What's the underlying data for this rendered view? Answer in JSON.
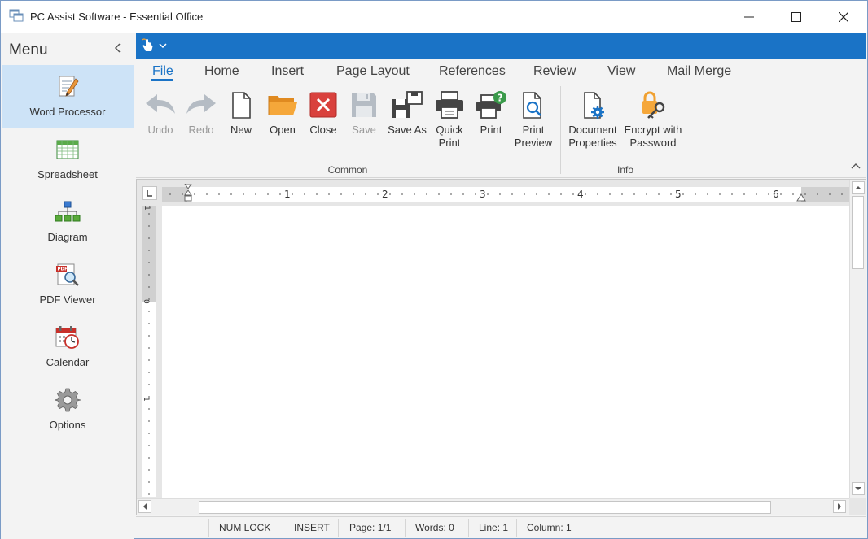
{
  "window": {
    "title": "PC Assist Software - Essential Office"
  },
  "sidebar": {
    "title": "Menu",
    "items": [
      {
        "label": "Word Processor",
        "icon": "word-processor-icon",
        "active": true
      },
      {
        "label": "Spreadsheet",
        "icon": "spreadsheet-icon"
      },
      {
        "label": "Diagram",
        "icon": "diagram-icon"
      },
      {
        "label": "PDF Viewer",
        "icon": "pdf-viewer-icon"
      },
      {
        "label": "Calendar",
        "icon": "calendar-icon"
      },
      {
        "label": "Options",
        "icon": "options-icon"
      }
    ]
  },
  "tabs": [
    "File",
    "Home",
    "Insert",
    "Page Layout",
    "References",
    "Review",
    "View",
    "Mail Merge"
  ],
  "active_tab": "File",
  "ribbon": {
    "groups": [
      {
        "label": "Common"
      },
      {
        "label": "Info"
      }
    ],
    "buttons": {
      "undo": {
        "label": "Undo",
        "disabled": true
      },
      "redo": {
        "label": "Redo",
        "disabled": true
      },
      "new": {
        "label": "New"
      },
      "open": {
        "label": "Open"
      },
      "close": {
        "label": "Close"
      },
      "save": {
        "label": "Save",
        "disabled": true
      },
      "save_as": {
        "label": "Save As"
      },
      "quick_print": {
        "label1": "Quick",
        "label2": "Print"
      },
      "print": {
        "label": "Print"
      },
      "print_preview": {
        "label1": "Print",
        "label2": "Preview"
      },
      "document_properties": {
        "label1": "Document",
        "label2": "Properties"
      },
      "encrypt": {
        "label1": "Encrypt with",
        "label2": "Password"
      }
    }
  },
  "ruler": {
    "numbers": [
      "1",
      "2",
      "3",
      "4",
      "5",
      "6"
    ],
    "vnumbers": [
      "1",
      "0",
      "1"
    ]
  },
  "statusbar": {
    "num_lock": "NUM LOCK",
    "mode": "INSERT",
    "page": "Page: 1/1",
    "words": "Words: 0",
    "line": "Line: 1",
    "column": "Column: 1"
  },
  "colors": {
    "accent": "#1a73c6",
    "active_nav": "#cde3f7",
    "close_red": "#d9413d",
    "open_orange": "#f0a030"
  }
}
